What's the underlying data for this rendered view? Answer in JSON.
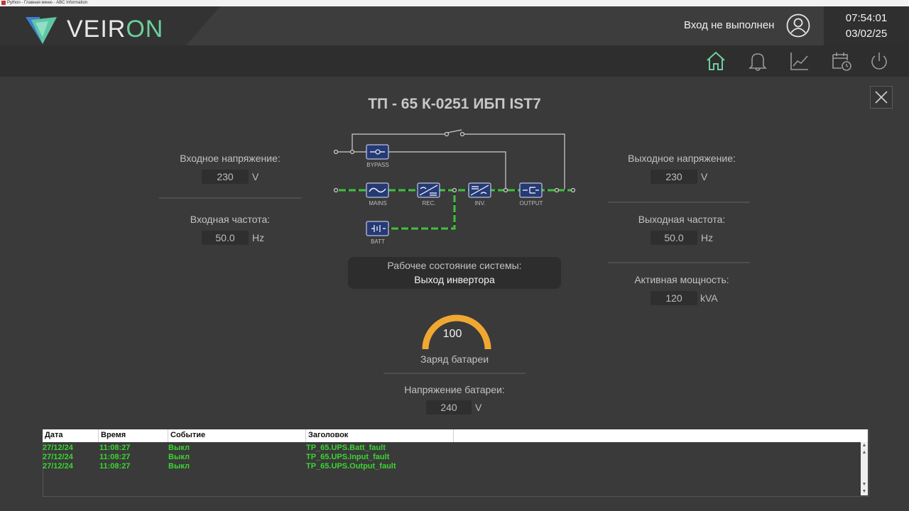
{
  "window": {
    "title": "Python - Главная меню - ABC Information"
  },
  "header": {
    "logo_part1": "VEIR",
    "logo_part2": "ON",
    "user_status": "Вход не выполнен",
    "time": "07:54:01",
    "date": "03/02/25"
  },
  "nav": {
    "items": [
      {
        "icon": "home-icon",
        "active": true
      },
      {
        "icon": "bell-icon",
        "active": false
      },
      {
        "icon": "trend-chart-icon",
        "active": false
      },
      {
        "icon": "calendar-clock-icon",
        "active": false
      },
      {
        "icon": "power-icon",
        "active": false
      }
    ],
    "accent": "#6ccf9b"
  },
  "main": {
    "title": "ТП - 65 К-0251 ИБП IST7",
    "input_voltage": {
      "label": "Входное напряжение:",
      "value": "230",
      "unit": "V"
    },
    "input_frequency": {
      "label": "Входная частота:",
      "value": "50.0",
      "unit": "Hz"
    },
    "output_voltage": {
      "label": "Выходное напряжение:",
      "value": "230",
      "unit": "V"
    },
    "output_frequency": {
      "label": "Выходная частота:",
      "value": "50.0",
      "unit": "Hz"
    },
    "active_power": {
      "label": "Активная мощность:",
      "value": "120",
      "unit": "kVA"
    },
    "system_state": {
      "label": "Рабочее состояние системы:",
      "value": "Выход инвертора"
    },
    "battery_charge": {
      "label": "Заряд батареи",
      "value": "100",
      "percent": 100
    },
    "battery_voltage": {
      "label": "Напряжение батареи:",
      "value": "240",
      "unit": "V"
    }
  },
  "diagram": {
    "blocks": {
      "bypass": "BYPASS",
      "mains": "MAINS",
      "rec": "REC.",
      "inv": "INV.",
      "output": "OUTPUT",
      "batt": "BATT"
    },
    "active_color": "#3ec23e"
  },
  "log": {
    "columns": [
      "Дата",
      "Время",
      "Событие",
      "Заголовок"
    ],
    "rows": [
      {
        "date": "27/12/24",
        "time": "11:08:27",
        "event": "Выкл",
        "tag": "TP_65.UPS.Batt_fault"
      },
      {
        "date": "27/12/24",
        "time": "11:08:27",
        "event": "Выкл",
        "tag": "TP_65.UPS.Input_fault"
      },
      {
        "date": "27/12/24",
        "time": "11:08:27",
        "event": "Выкл",
        "tag": "TP_65.UPS.Output_fault"
      }
    ]
  }
}
